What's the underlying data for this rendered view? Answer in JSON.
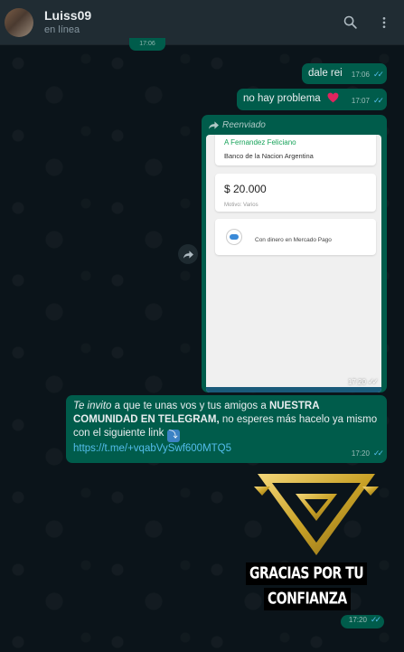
{
  "header": {
    "contact_name": "Luiss09",
    "status": "en línea",
    "icons": [
      "search-icon",
      "more-vert-icon"
    ]
  },
  "previous_time": "17:06",
  "messages": [
    {
      "text": "dale rei",
      "time": "17:06"
    },
    {
      "text": "no hay problema",
      "time": "17:07",
      "emoji": "red-heart"
    },
    {
      "forwarded_label": "Reenviado",
      "time": "17:20",
      "screenshot": {
        "recipient": "A Fernandez Feliciano",
        "bank": "Banco de la Nacion Argentina",
        "amount": "$ 20.000",
        "motivo": "Motivo: Varios",
        "payment_method": "Con dinero en Mercado Pago"
      }
    },
    {
      "time": "17:20",
      "italic_part": "Te invito",
      "part2": " a que te unas vos y tus amigos a ",
      "bold_part": "NUESTRA COMUNIDAD EN TELEGRAM,",
      "part3": " no esperes más hacelo ya mismo con el siguiente link ",
      "emoji": "down-arrow",
      "link": "https://t.me/+vqabVySwf600MTQ5"
    },
    {
      "sticker_line1": "GRACIAS POR TU",
      "sticker_line2": "CONFIANZA",
      "time": "17:20"
    }
  ],
  "colors": {
    "header_bg": "#202c33",
    "chat_bg": "#0b141a",
    "outgoing_bubble": "#005c4b",
    "read_ticks": "#53bdeb",
    "link": "#53bdeb",
    "gold": "#c9a227"
  }
}
